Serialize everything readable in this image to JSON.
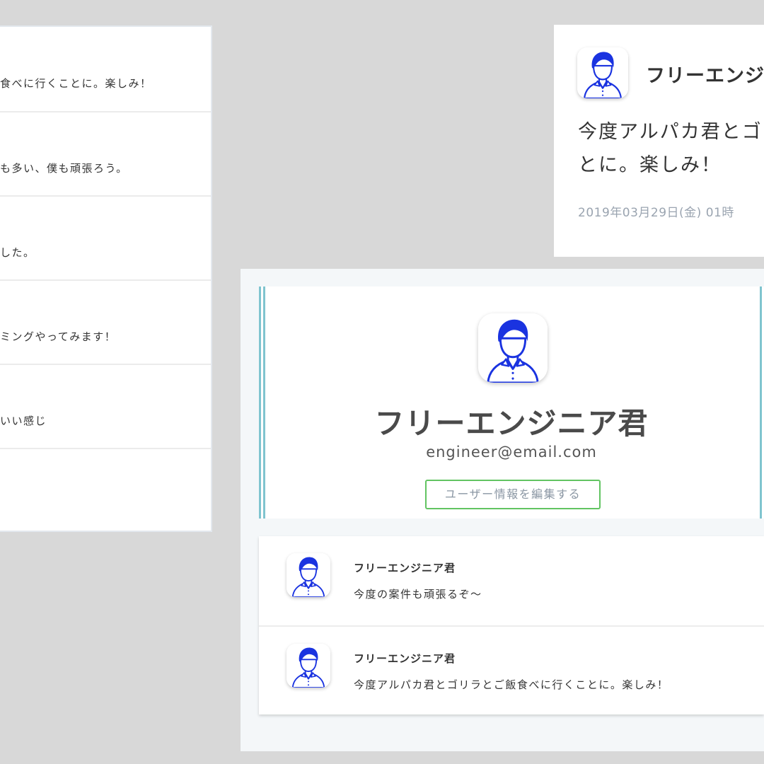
{
  "left_feed": {
    "rows": [
      {
        "text": "食べに行くことに。楽しみ！"
      },
      {
        "text": "も多い、僕も頑張ろう。"
      },
      {
        "text": "した。"
      },
      {
        "text": "ミングやってみます！"
      },
      {
        "text": "いい感じ"
      },
      {
        "text": ""
      }
    ]
  },
  "post": {
    "author": "フリーエンジ",
    "body_line1": "今度アルパカ君とゴ",
    "body_line2": "とに。楽しみ！",
    "date": "2019年03月29日(金) 01時"
  },
  "profile": {
    "name": "フリーエンジニア君",
    "email": "engineer@email.com",
    "edit_button_label": "ユーザー情報を編集する",
    "posts": [
      {
        "author": "フリーエンジニア君",
        "text": "今度の案件も頑張るぞ〜"
      },
      {
        "author": "フリーエンジニア君",
        "text": "今度アルパカ君とゴリラとご飯食べに行くことに。楽しみ！"
      }
    ]
  },
  "colors": {
    "background": "#d8d8d8",
    "accent_blue": "#1a33e0",
    "button_border": "#62c462",
    "teal_bar": "#7fc4cf",
    "muted_text": "#9aa4b0"
  }
}
